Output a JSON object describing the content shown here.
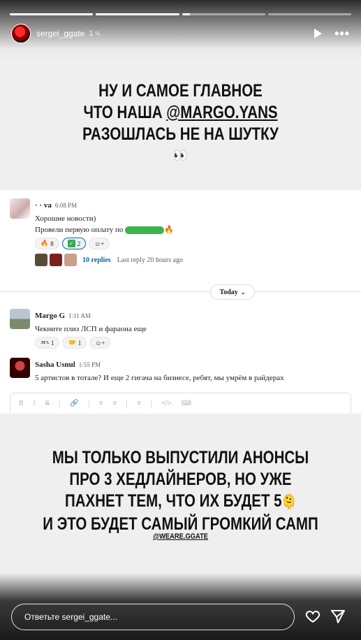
{
  "story": {
    "progress": [
      1.0,
      1.0,
      0.1,
      0.0
    ],
    "username": "sergei_ggate",
    "time": "1 ч."
  },
  "caption_top": {
    "line1": "НУ И САМОЕ ГЛАВНОЕ",
    "line2_prefix": "ЧТО НАША ",
    "line2_mention": "@MARGO.YANS",
    "line3": "РАЗОШЛАСЬ НЕ НА ШУТКУ",
    "emoji": "👀"
  },
  "slack": {
    "msg1": {
      "name": "· ·                    va",
      "time": "6:08 PM",
      "line1": "Хорошие новости)",
      "line2": "Провели первую оплату по",
      "fire": "🔥",
      "reactions": [
        {
          "emoji": "🔥",
          "count": "8"
        },
        {
          "emoji": "✅",
          "count": "2"
        },
        {
          "emoji": "☺+",
          "count": ""
        }
      ],
      "replies": "10 replies",
      "last_reply": "Last reply 20 hours ago"
    },
    "today_label": "Today",
    "msg2": {
      "name": "Margo G",
      "time": "1:11 AM",
      "line1": "Чекните плиз ЛСП и фараона еще",
      "reactions": [
        {
          "emoji": "ЛГА",
          "count": "1"
        },
        {
          "emoji": "🤝",
          "count": "1"
        },
        {
          "emoji": "☺+",
          "count": ""
        }
      ]
    },
    "msg3": {
      "name": "Sasha Usnul",
      "time": "1:55 PM",
      "line1": "5 артистов в тотале? И еще 2 гигача на бизнесе, ребят, мы умрём в райдерах"
    },
    "toolbar": [
      "B",
      "I",
      "S",
      "🔗",
      "≡",
      "≡",
      "≡",
      "</>",
      "⌨"
    ]
  },
  "caption_bottom": {
    "line1": "МЫ ТОЛЬКО ВЫПУСТИЛИ АНОНСЫ",
    "line2": "ПРО 3 ХЕДЛАЙНЕРОВ, НО УЖЕ",
    "line3": "ПАХНЕТ ТЕМ, ЧТО ИХ БУДЕТ 5",
    "line3_emoji": "🫠",
    "line4": "И ЭТО БУДЕТ САМЫЙ ГРОМКИЙ САМП",
    "handle": "@WEARE.GGATE"
  },
  "reply": {
    "placeholder": "Ответьте sergei_ggate..."
  }
}
